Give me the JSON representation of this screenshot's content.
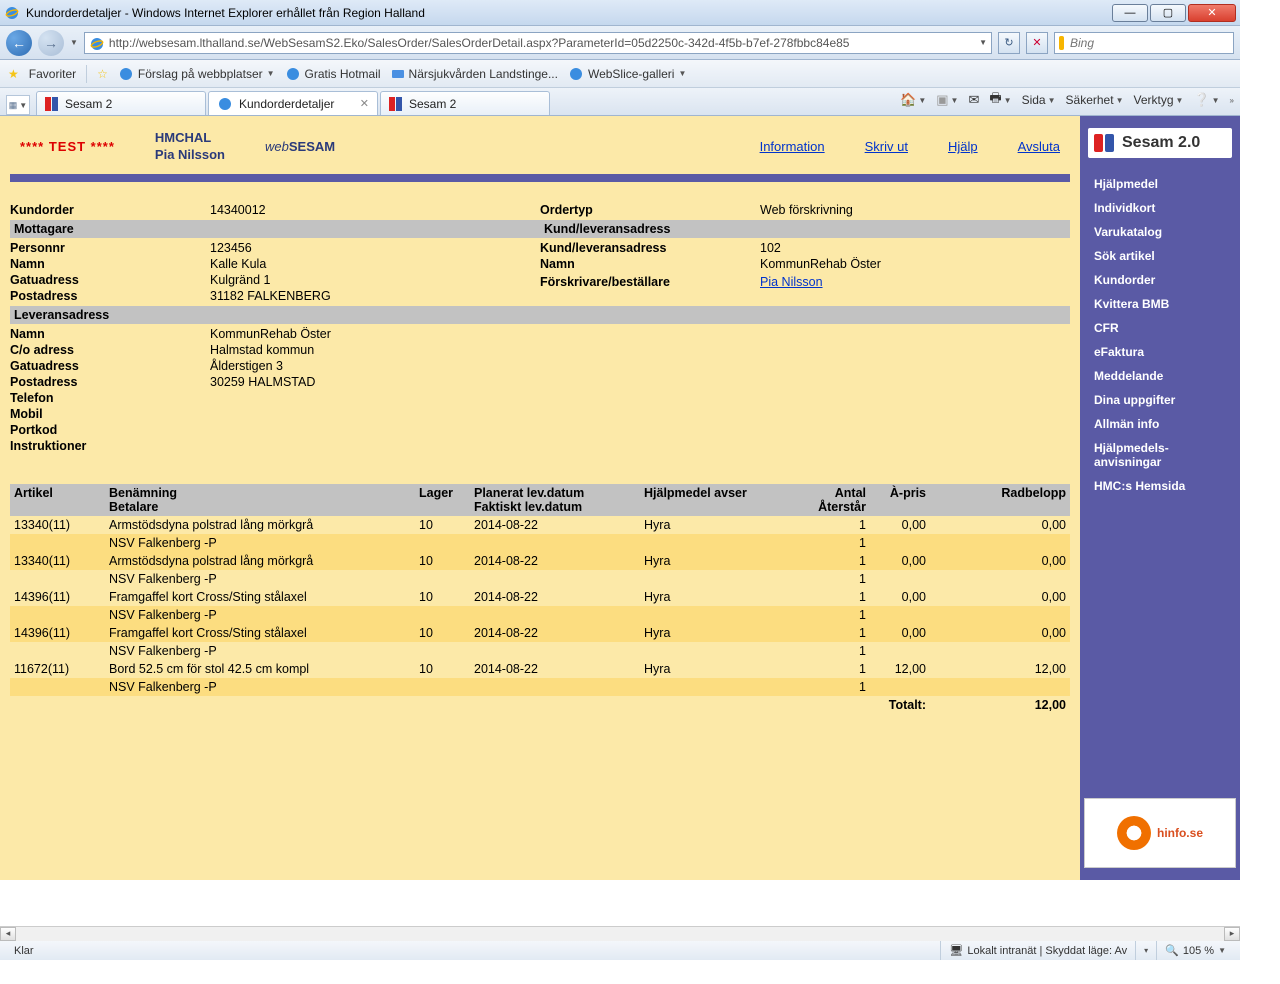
{
  "window": {
    "title": "Kundorderdetaljer - Windows Internet Explorer erhållet från Region Halland",
    "min": "—",
    "max": "▢",
    "close": "✕"
  },
  "nav": {
    "back": "←",
    "forward": "→",
    "url": "http://websesam.lthalland.se/WebSesamS2.Eko/SalesOrder/SalesOrderDetail.aspx?ParameterId=05d2250c-342d-4f5b-b7ef-278fbbc84e85",
    "reload": "↻",
    "stop": "✕",
    "search_placeholder": "Bing"
  },
  "fav": {
    "label": "Favoriter",
    "items": [
      "Förslag på webbplatser",
      "Gratis Hotmail",
      "Närsjukvården Landstinge...",
      "WebSlice-galleri"
    ]
  },
  "tabs": {
    "list": [
      {
        "label": "Sesam 2",
        "active": false
      },
      {
        "label": "Kundorderdetaljer",
        "active": true
      },
      {
        "label": "Sesam 2",
        "active": false
      }
    ]
  },
  "cmd": {
    "page": "Sida",
    "safety": "Säkerhet",
    "tools": "Verktyg"
  },
  "header": {
    "test": "**** TEST ****",
    "userCode": "HMCHAL",
    "userName": "Pia Nilsson",
    "brandItalic": "web",
    "brandBold": "SESAM",
    "links": {
      "info": "Information",
      "print": "Skriv ut",
      "help": "Hjälp",
      "logout": "Avsluta"
    }
  },
  "sidebar": {
    "logo": "Sesam 2.0",
    "items": [
      "Hjälpmedel",
      "Individkort",
      "Varukatalog",
      "Sök artikel",
      "Kundorder",
      "Kvittera BMB",
      "CFR",
      "eFaktura",
      "Meddelande",
      "Dina uppgifter",
      "Allmän info",
      "Hjälpmedels-anvisningar",
      "HMC:s Hemsida"
    ]
  },
  "details": {
    "labels": {
      "kundorder": "Kundorder",
      "ordertyp": "Ordertyp",
      "mottagare": "Mottagare",
      "kundlev": "Kund/leveransadress",
      "personnr": "Personnr",
      "namn": "Namn",
      "gatu": "Gatuadress",
      "post": "Postadress",
      "forskrivare": "Förskrivare/beställare",
      "levadr": "Leveransadress",
      "co": "C/o adress",
      "telefon": "Telefon",
      "mobil": "Mobil",
      "portkod": "Portkod",
      "instr": "Instruktioner"
    },
    "v": {
      "kundorder": "14340012",
      "ordertyp": "Web förskrivning",
      "personnr": "123456",
      "kundlevnr": "102",
      "namn": "Kalle Kula",
      "kundlevnamn": "KommunRehab Öster",
      "gatu": "Kulgränd 1",
      "post": "31182  FALKENBERG",
      "forskrivare": "Pia Nilsson",
      "lev_namn": "KommunRehab Öster",
      "lev_co": "Halmstad kommun",
      "lev_gatu": "Ålderstigen 3",
      "lev_post": "30259  HALMSTAD"
    }
  },
  "table": {
    "headers": {
      "artikel": "Artikel",
      "benamning": "Benämning",
      "betalare": "Betalare",
      "lager": "Lager",
      "planerat": "Planerat lev.datum",
      "faktiskt": "Faktiskt lev.datum",
      "avser": "Hjälpmedel avser",
      "antal": "Antal",
      "aterstar": "Återstår",
      "apris": "À-pris",
      "radbelopp": "Radbelopp"
    },
    "rows": [
      {
        "art": "13340(11)",
        "ben": "Armstödsdyna polstrad lång mörkgrå",
        "bet": "NSV Falkenberg -P",
        "lager": "10",
        "plan": "2014-08-22",
        "avser": "Hyra",
        "antal": "1",
        "ater": "1",
        "pris": "0,00",
        "bel": "0,00"
      },
      {
        "art": "13340(11)",
        "ben": "Armstödsdyna polstrad lång mörkgrå",
        "bet": "NSV Falkenberg -P",
        "lager": "10",
        "plan": "2014-08-22",
        "avser": "Hyra",
        "antal": "1",
        "ater": "1",
        "pris": "0,00",
        "bel": "0,00"
      },
      {
        "art": "14396(11)",
        "ben": "Framgaffel kort Cross/Sting stålaxel",
        "bet": "NSV Falkenberg -P",
        "lager": "10",
        "plan": "2014-08-22",
        "avser": "Hyra",
        "antal": "1",
        "ater": "1",
        "pris": "0,00",
        "bel": "0,00"
      },
      {
        "art": "14396(11)",
        "ben": "Framgaffel kort Cross/Sting stålaxel",
        "bet": "NSV Falkenberg -P",
        "lager": "10",
        "plan": "2014-08-22",
        "avser": "Hyra",
        "antal": "1",
        "ater": "1",
        "pris": "0,00",
        "bel": "0,00"
      },
      {
        "art": "11672(11)",
        "ben": "Bord 52.5 cm för stol 42.5 cm kompl",
        "bet": "NSV Falkenberg -P",
        "lager": "10",
        "plan": "2014-08-22",
        "avser": "Hyra",
        "antal": "1",
        "ater": "1",
        "pris": "12,00",
        "bel": "12,00"
      }
    ],
    "totalLabel": "Totalt:",
    "total": "12,00"
  },
  "status": {
    "ready": "Klar",
    "zone": "Lokalt intranät | Skyddat läge: Av",
    "zoom": "105 %"
  },
  "hinfo": "hinfo.se"
}
